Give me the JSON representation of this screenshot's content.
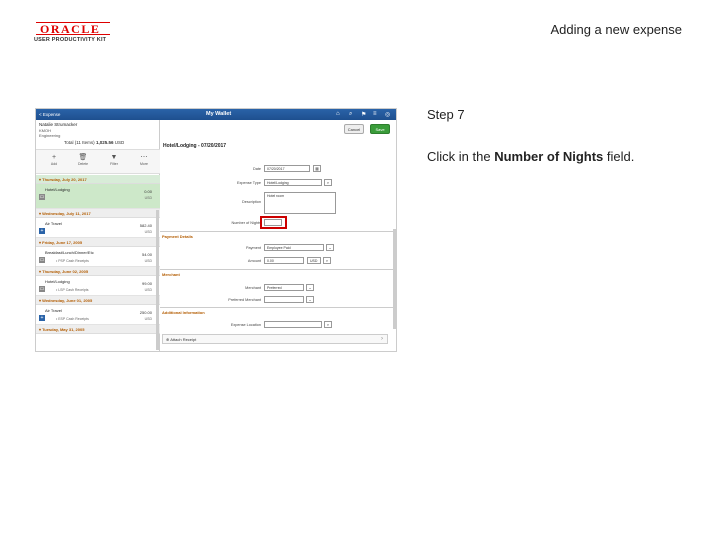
{
  "header": {
    "brand": "ORACLE",
    "kit": "USER PRODUCTIVITY KIT",
    "slide_title": "Adding a new expense"
  },
  "instruction_pane": {
    "step": "Step 7",
    "text_before": "Click in the ",
    "text_bold": "Number of Nights",
    "text_after": " field."
  },
  "app": {
    "back_label": "< Expense",
    "title": "My Wallet",
    "user": {
      "name": "Natalie Strumacker",
      "id": "KMOH",
      "sub": "Engineering"
    },
    "total_label": "Total (11 Items)",
    "total_amount": "1,025.56",
    "total_currency": "USD",
    "toolbar": [
      {
        "label": "Add",
        "glyph": "+"
      },
      {
        "label": "Delete",
        "glyph": "🗑"
      },
      {
        "label": "Filter",
        "glyph": "▼"
      },
      {
        "label": "More",
        "glyph": "⋯"
      }
    ],
    "days": [
      {
        "header": "▾ Thursday, July 20, 2017",
        "selected": true,
        "rows": [
          {
            "name": "Hotel/Lodging",
            "amount": "0.00",
            "currency": "USD",
            "sub": "",
            "selected": true
          }
        ]
      },
      {
        "header": "▾ Wednesday, July 11, 2017",
        "selected": false,
        "rows": [
          {
            "name": "Air Travel",
            "amount": "582.40",
            "currency": "USD",
            "sub": "",
            "selected": false
          }
        ]
      },
      {
        "header": "▾ Friday, June 17, 2005",
        "selected": false,
        "rows": [
          {
            "name": "Breakfast/Lunch/Dinner/Etc",
            "amount": "54.00",
            "currency": "USD",
            "sub": "• PSP Cash Receipts",
            "selected": false
          }
        ]
      },
      {
        "header": "▾ Thursday, June 02, 2005",
        "selected": false,
        "rows": [
          {
            "name": "Hotel/Lodging",
            "amount": "99.00",
            "currency": "USD",
            "sub": "• LSP Cash Receipts",
            "selected": false
          }
        ]
      },
      {
        "header": "▾ Wednesday, June 01, 2005",
        "selected": false,
        "rows": [
          {
            "name": "Air Travel",
            "amount": "250.00",
            "currency": "USD",
            "sub": "• ESP Cash Receipts",
            "selected": false
          }
        ]
      },
      {
        "header": "▾ Tuesday, May 31, 2005",
        "selected": false,
        "rows": []
      }
    ],
    "buttons": {
      "cancel": "Cancel",
      "save": "Save"
    },
    "detail": {
      "title": "Hotel/Lodging - 07/20/2017",
      "date_label": "Date",
      "date_value": "07/20/2017",
      "expense_type_label": "Expense Type",
      "expense_type_value": "Hotel/Lodging",
      "description_label": "Description",
      "description_value": "Hotel room",
      "nights_label": "Number of Nights",
      "payment_section": "Payment Details",
      "payment_label": "Payment",
      "payment_value": "Employee Paid",
      "amount_label": "Amount",
      "amount_value": "0.00",
      "currency_value": "USD",
      "merchant_section": "Merchant",
      "merchant_label": "Merchant",
      "merchant_value": "Preferred",
      "pref_merchant_label": "Preferred Merchant",
      "additional_section": "Additional Information",
      "expense_location_label": "Expense Location",
      "attach_label": "⊕ Attach Receipt",
      "chevron": "›"
    }
  }
}
